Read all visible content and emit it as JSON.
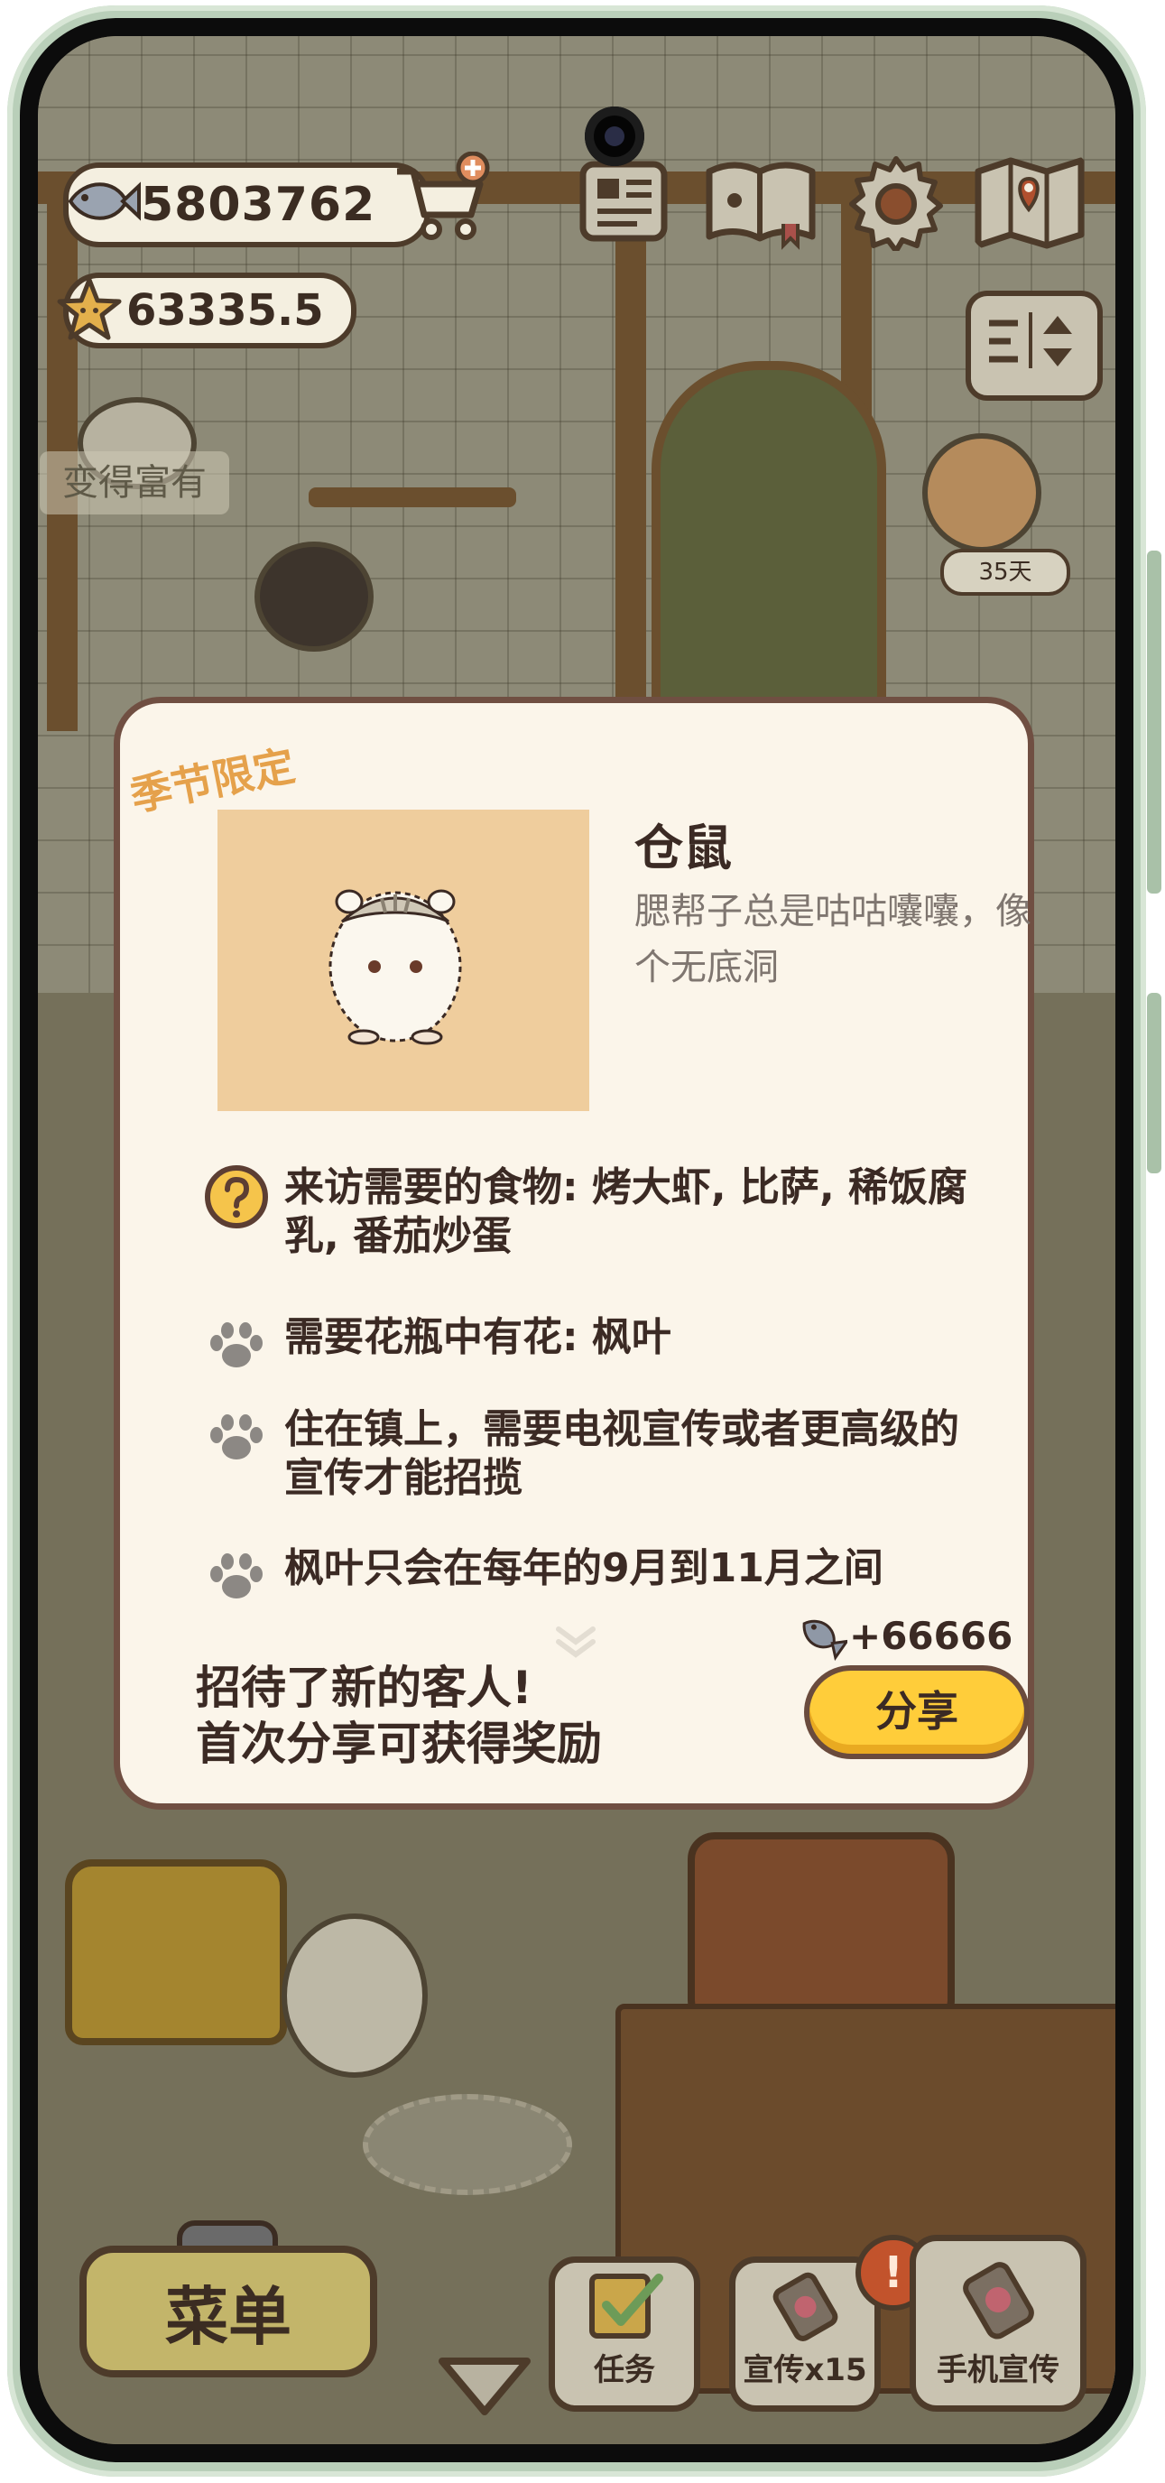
{
  "hud": {
    "coins": "5803762",
    "stars": "63335.5",
    "rich_label": "变得富有",
    "days_badge": "35天"
  },
  "card": {
    "season_tag": "季节限定",
    "guest_name": "仓鼠",
    "guest_description": "腮帮子总是咕咕囔囔，像个无底洞",
    "requirements": [
      {
        "icon": "question-icon",
        "text": "来访需要的食物: 烤大虾, 比萨, 稀饭腐乳, 番茄炒蛋"
      },
      {
        "icon": "paw-icon",
        "text": "需要花瓶中有花: 枫叶"
      },
      {
        "icon": "paw-icon",
        "text": "住在镇上，需要电视宣传或者更高级的宣传才能招揽"
      },
      {
        "icon": "paw-icon",
        "text": "枫叶只会在每年的9月到11月之间"
      }
    ],
    "reward": "+66666",
    "invite_line1": "招待了新的客人!",
    "invite_line2": "首次分享可获得奖励",
    "share_label": "分享"
  },
  "bottom": {
    "menu_label": "菜单",
    "task_label": "任务",
    "promo_label": "宣传x15",
    "phone_promo_label": "手机宣传",
    "alert_mark": "!"
  },
  "colors": {
    "card_bg": "#fbf5ea",
    "card_border": "#704f42",
    "share_button": "#ffcd3a",
    "season_tag": "#e5a14b",
    "portrait_bg": "#efcd9d"
  }
}
